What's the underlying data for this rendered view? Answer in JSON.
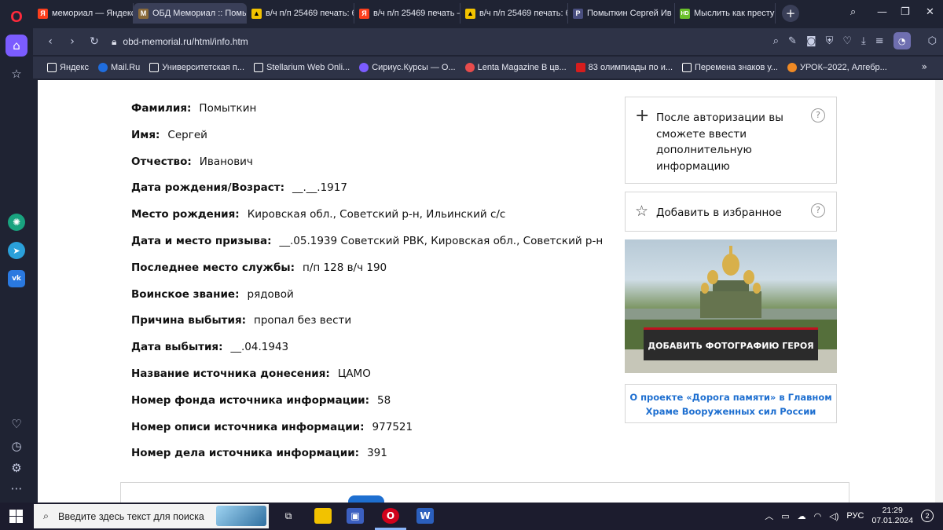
{
  "tabs": [
    {
      "label": "мемориал — Яндекс: н",
      "icon": "yandex-favicon",
      "badge": "Я"
    },
    {
      "label": "ОБД Мемориал :: Помыт",
      "icon": "obd-favicon",
      "badge": "M",
      "active": true
    },
    {
      "label": "в/ч п/п 25469 печать: б",
      "icon": "yandex-images-favicon",
      "badge": "▲"
    },
    {
      "label": "в/ч п/п 25469 печать –",
      "icon": "yandex-favicon",
      "badge": "Я"
    },
    {
      "label": "в/ч п/п 25469 печать: б",
      "icon": "yandex-images-favicon",
      "badge": "▲"
    },
    {
      "label": "Помыткин Сергей Ив",
      "icon": "pamyat-favicon",
      "badge": "P"
    },
    {
      "label": "Мыслить как преступ",
      "icon": "hd-favicon",
      "badge": "HD"
    }
  ],
  "address": {
    "url": "obd-memorial.ru/html/info.htm"
  },
  "bookmarks": [
    {
      "label": "Яндекс",
      "color": "#ffffff"
    },
    {
      "label": "Mail.Ru",
      "color": "#1f6dde"
    },
    {
      "label": "Университетская п...",
      "color": "#ffffff"
    },
    {
      "label": "Stellarium Web Onli...",
      "color": "#ffffff"
    },
    {
      "label": "Сириус.Курсы — О...",
      "color": "#7b5cff"
    },
    {
      "label": "Lenta Magazine В цв...",
      "color": "#e84c4c"
    },
    {
      "label": "83 олимпиады по и...",
      "color": "#d61d1d"
    },
    {
      "label": "Перемена знаков у...",
      "color": "#ffffff"
    },
    {
      "label": "УРОК–2022, Алгебр...",
      "color": "#f08a24"
    }
  ],
  "record": [
    {
      "label": "Фамилия",
      "value": "Помыткин"
    },
    {
      "label": "Имя",
      "value": "Сергей"
    },
    {
      "label": "Отчество",
      "value": "Иванович"
    },
    {
      "label": "Дата рождения/Возраст",
      "value": "__.__.1917"
    },
    {
      "label": "Место рождения",
      "value": "Кировская обл., Советский р-н, Ильинский с/с"
    },
    {
      "label": "Дата и место призыва",
      "value": "__.05.1939 Советский РВК, Кировская обл., Советский р-н"
    },
    {
      "label": "Последнее место службы",
      "value": "п/п 128 в/ч 190"
    },
    {
      "label": "Воинское звание",
      "value": "рядовой"
    },
    {
      "label": "Причина выбытия",
      "value": "пропал без вести"
    },
    {
      "label": "Дата выбытия",
      "value": "__.04.1943"
    },
    {
      "label": "Название источника донесения",
      "value": "ЦАМО"
    },
    {
      "label": "Номер фонда источника информации",
      "value": "58"
    },
    {
      "label": "Номер описи источника информации",
      "value": "977521"
    },
    {
      "label": "Номер дела источника информации",
      "value": "391"
    }
  ],
  "side": {
    "auth_text": "После авторизации вы сможете ввести дополнительную информацию",
    "favorite_text": "Добавить в избранное",
    "help_glyph": "?",
    "add_photo": "ДОБАВИТЬ ФОТОГРАФИЮ ГЕРОЯ",
    "about_link": "О проекте «Дорога памяти» в Главном Храме Вооруженных сил России"
  },
  "taskbar": {
    "search_placeholder": "Введите здесь текст для поиска",
    "lang": "РУС",
    "time": "21:29",
    "date": "07.01.2024",
    "notifications": "2"
  },
  "colors": {
    "accent": "#7b5cff",
    "link": "#1e6fd0",
    "photo_button_border": "#c1121f"
  }
}
